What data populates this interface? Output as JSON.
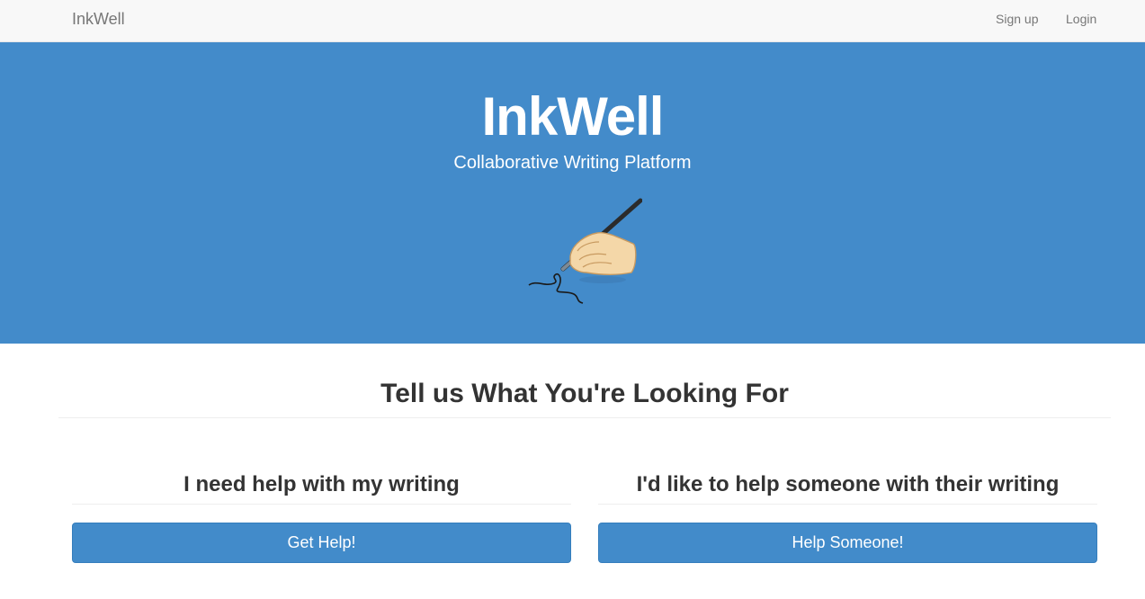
{
  "navbar": {
    "brand": "InkWell",
    "links": [
      "Sign up",
      "Login"
    ]
  },
  "hero": {
    "title": "InkWell",
    "subtitle": "Collaborative Writing Platform",
    "illustration_icon": "hand-writing-with-pen-icon"
  },
  "main": {
    "heading": "Tell us What You're Looking For",
    "options": [
      {
        "heading": "I need help with my writing",
        "button_label": "Get Help!"
      },
      {
        "heading": "I'd like to help someone with their writing",
        "button_label": "Help Someone!"
      }
    ]
  },
  "colors": {
    "navbar_bg": "#f8f8f8",
    "hero_bg": "#438bca",
    "button_bg": "#428bca",
    "text": "#333333"
  }
}
